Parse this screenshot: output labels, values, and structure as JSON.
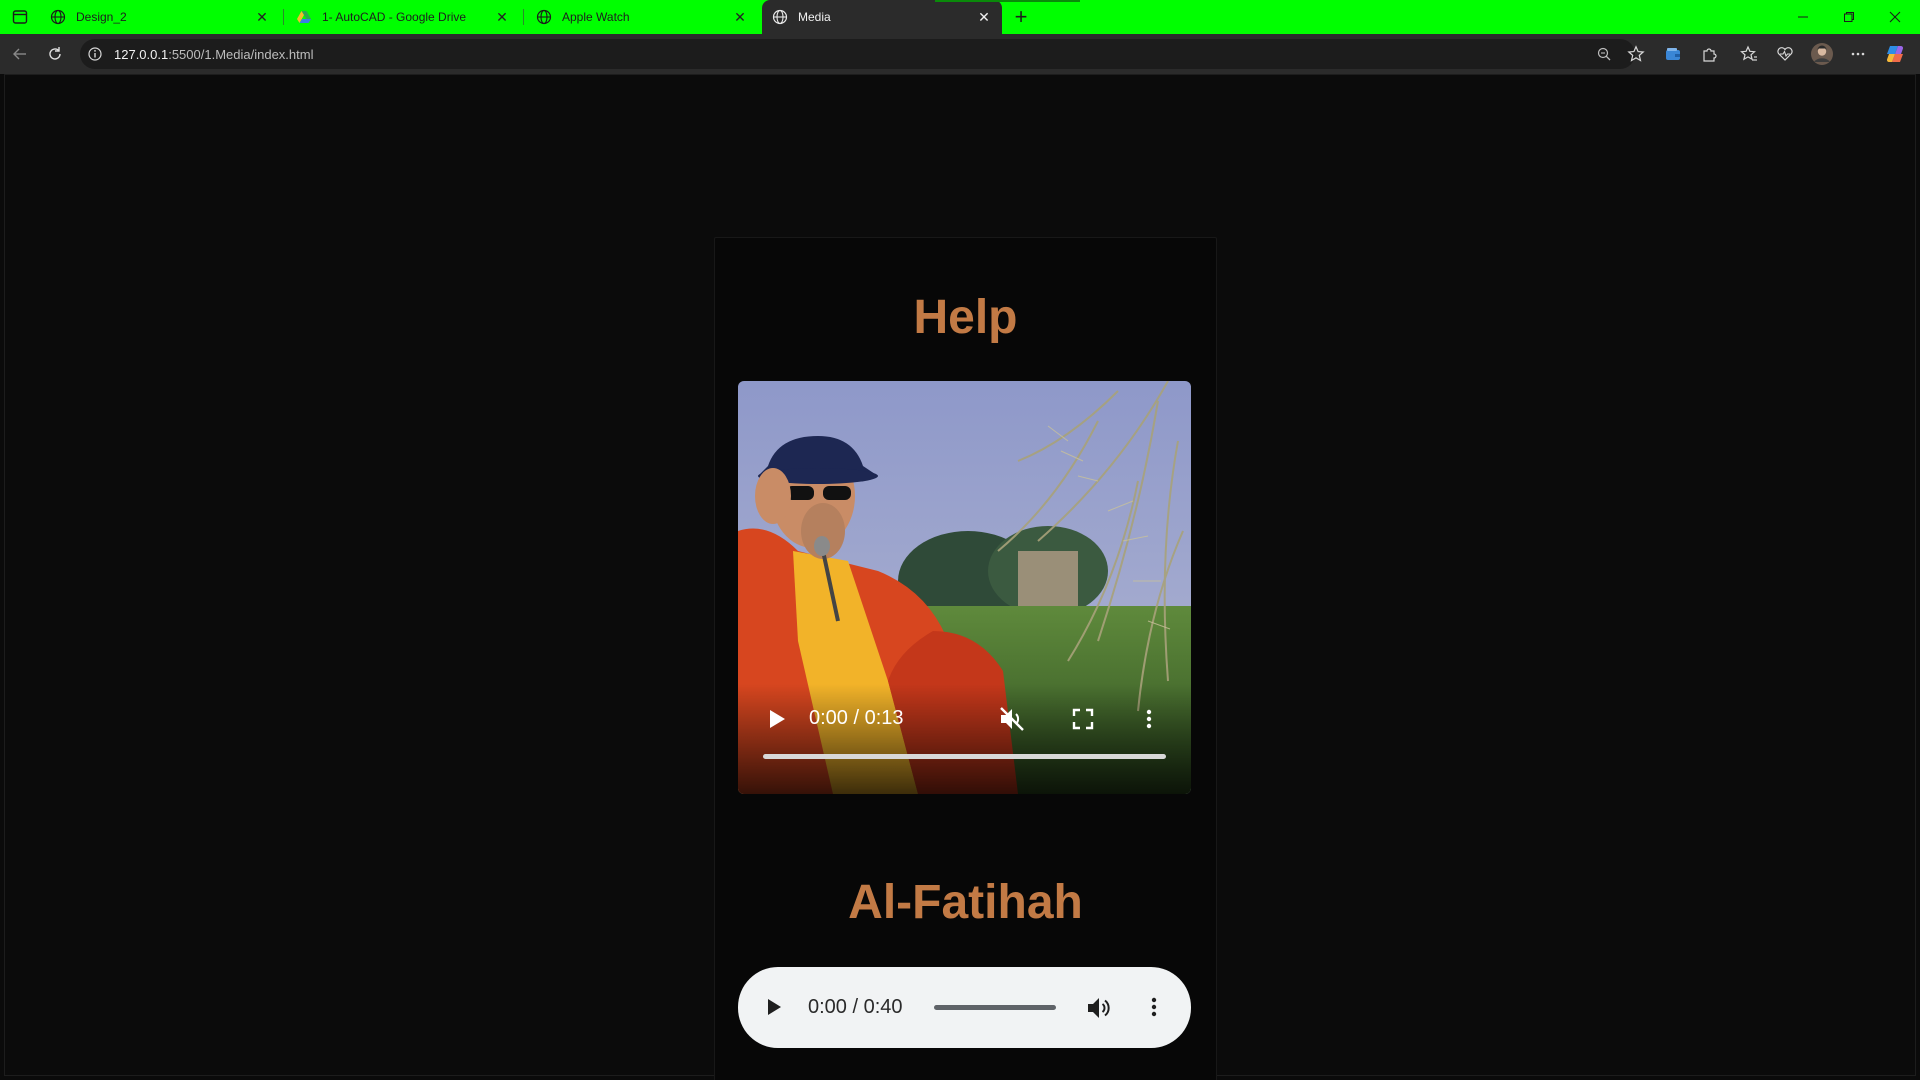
{
  "browser": {
    "tabs": [
      {
        "title": "Design_2",
        "icon": "globe-icon",
        "active": false
      },
      {
        "title": "1- AutoCAD - Google Drive",
        "icon": "google-drive-icon",
        "active": false
      },
      {
        "title": "Apple Watch",
        "icon": "globe-icon",
        "active": false
      },
      {
        "title": "Media",
        "icon": "globe-icon",
        "active": true
      }
    ],
    "new_tab_label": "+",
    "address": {
      "host": "127.0.0.1",
      "rest": ":5500/1.Media/index.html"
    },
    "tabbar_color": "#00ff00"
  },
  "page": {
    "video_section": {
      "heading": "Help",
      "player": {
        "time": "0:00 / 0:13",
        "muted": true,
        "progress": 0
      }
    },
    "audio_section": {
      "heading": "Al-Fatihah",
      "player": {
        "time": "0:00 / 0:40",
        "progress": 0
      }
    },
    "heading_color": "#c27a45"
  }
}
